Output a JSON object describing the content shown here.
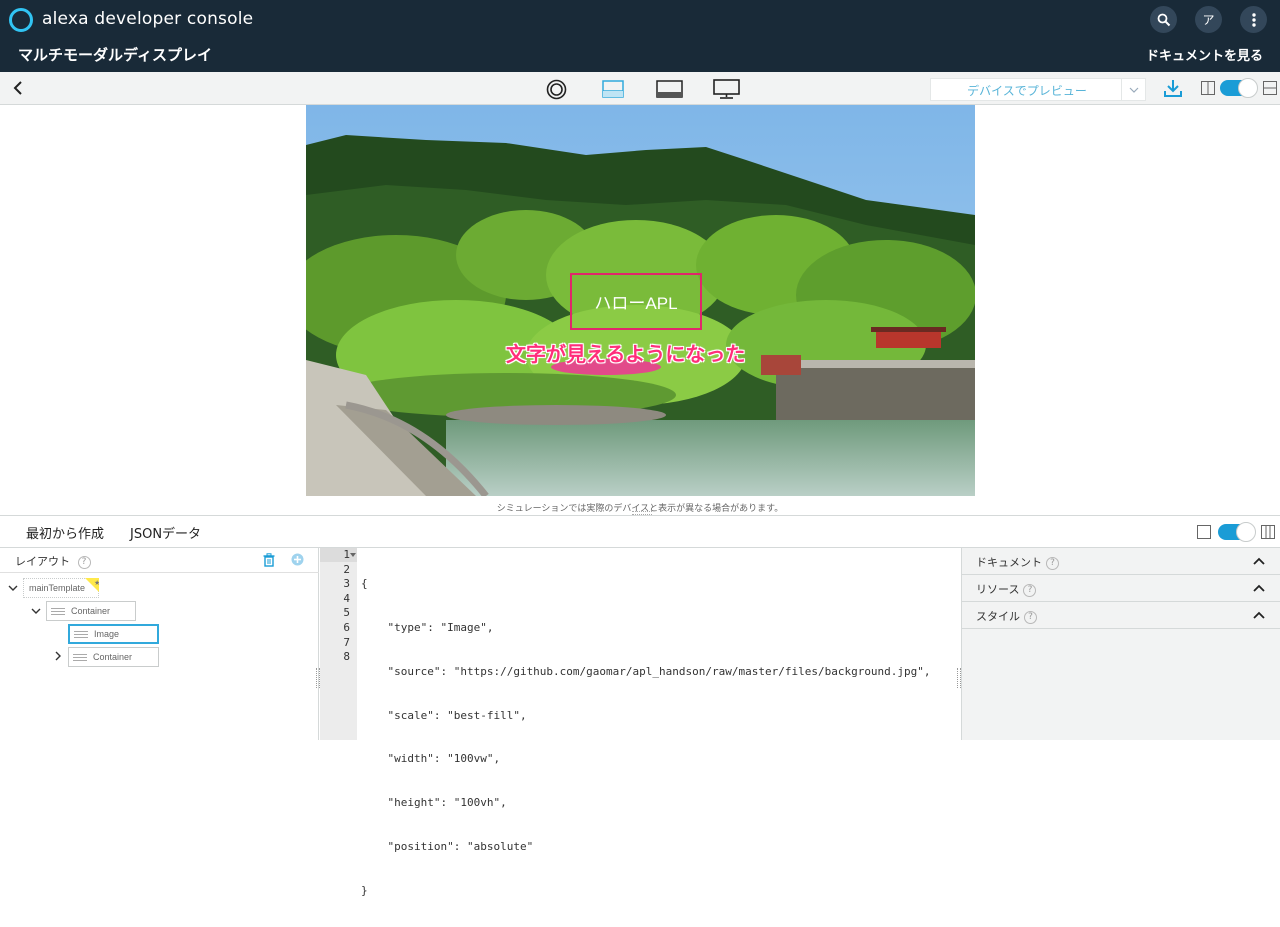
{
  "header": {
    "brand": "alexa developer console",
    "page_title": "マルチモーダルディスプレイ",
    "doc_link": "ドキュメントを見る",
    "avatar_label": "ア"
  },
  "toolbar": {
    "preview_device_label": "デバイスでプレビュー",
    "device_icons": [
      "round-display-icon",
      "landscape-small-icon",
      "landscape-large-icon",
      "tv-icon"
    ]
  },
  "preview": {
    "hello_text": "ハローAPL",
    "annotation": "文字が見えるようになった",
    "simulation_note": "シミュレーションでは実際のデバイスと表示が異なる場合があります。"
  },
  "tabs": [
    {
      "label": "最初から作成",
      "active": true
    },
    {
      "label": "JSONデータ",
      "active": false
    }
  ],
  "layout_panel": {
    "title": "レイアウト",
    "tree": [
      {
        "label": "mainTemplate",
        "depth": 0
      },
      {
        "label": "Container",
        "depth": 1
      },
      {
        "label": "Image",
        "depth": 2,
        "selected": true
      },
      {
        "label": "Container",
        "depth": 2
      }
    ]
  },
  "editor": {
    "line_numbers": [
      "1",
      "2",
      "3",
      "4",
      "5",
      "6",
      "7",
      "8"
    ],
    "lines": [
      "{",
      "    \"type\": \"Image\",",
      "    \"source\": \"https://github.com/gaomar/apl_handson/raw/master/files/background.jpg\",",
      "    \"scale\": \"best-fill\",",
      "    \"width\": \"100vw\",",
      "    \"height\": \"100vh\",",
      "    \"position\": \"absolute\"",
      "}"
    ]
  },
  "right_panel": {
    "sections": [
      "ドキュメント",
      "リソース",
      "スタイル"
    ]
  },
  "colors": {
    "header_bg": "#192a38",
    "accent": "#1a9cd6",
    "annotation": "#ff2e7a",
    "highlight_box": "#e0266b"
  }
}
